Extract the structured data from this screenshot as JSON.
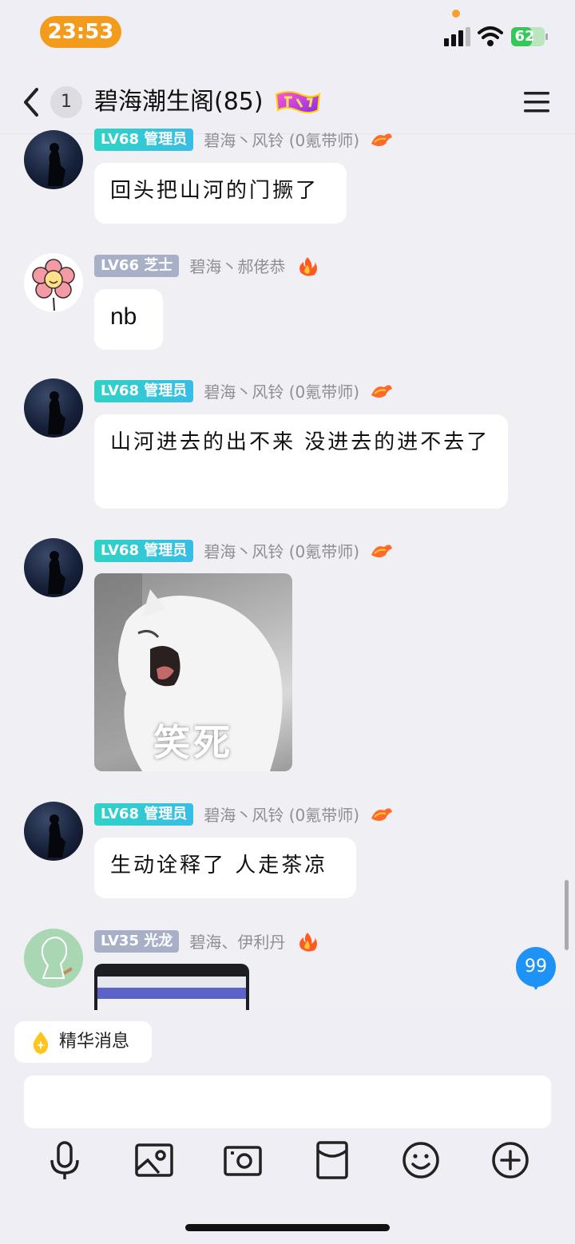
{
  "status_bar": {
    "time": "23:53",
    "battery_level": "62",
    "battery_fraction": 0.62,
    "signal_icon": "signal-icon",
    "wifi_icon": "wifi-icon"
  },
  "header": {
    "back_icon": "chevron-left-icon",
    "unread_count": "1",
    "title": "碧海潮生阁(85)",
    "badge_icon": "flag-badge-icon",
    "menu_icon": "hamburger-menu-icon"
  },
  "messages": [
    {
      "level": "LV68",
      "role": "管理员",
      "nickname": "碧海丶风铃 (0氪带师)",
      "role_icon": "dragon-icon",
      "text": "回头把山河的门撅了"
    },
    {
      "level": "LV66",
      "role": "芝士",
      "nickname": "碧海丶郝佬恭",
      "role_icon": "fire-icon",
      "text": "nb"
    },
    {
      "level": "LV68",
      "role": "管理员",
      "nickname": "碧海丶风铃 (0氪带师)",
      "role_icon": "dragon-icon",
      "text": "山河进去的出不来 没进去的进不去了"
    },
    {
      "level": "LV68",
      "role": "管理员",
      "nickname": "碧海丶风铃 (0氪带师)",
      "role_icon": "dragon-icon",
      "sticker_caption": "笑死"
    },
    {
      "level": "LV68",
      "role": "管理员",
      "nickname": "碧海丶风铃 (0氪带师)",
      "role_icon": "dragon-icon",
      "text": "生动诠释了 人走茶凉"
    },
    {
      "level": "LV35",
      "role": "光龙",
      "nickname": "碧海、伊利丹",
      "role_icon": "fire-icon"
    }
  ],
  "new_message_count": "99",
  "bottom": {
    "essence_label": "精华消息",
    "essence_icon": "drop-sparkle-icon",
    "input_value": "",
    "tools": [
      "microphone-icon",
      "image-icon",
      "camera-icon",
      "red-packet-icon",
      "emoji-icon",
      "plus-icon"
    ]
  },
  "colors": {
    "admin_badge": "#2fd3c6",
    "grey_badge": "#a7b0c7",
    "time_pill": "#f29b1c",
    "new_message_badge": "#1f93f5",
    "battery": "#35c759"
  }
}
